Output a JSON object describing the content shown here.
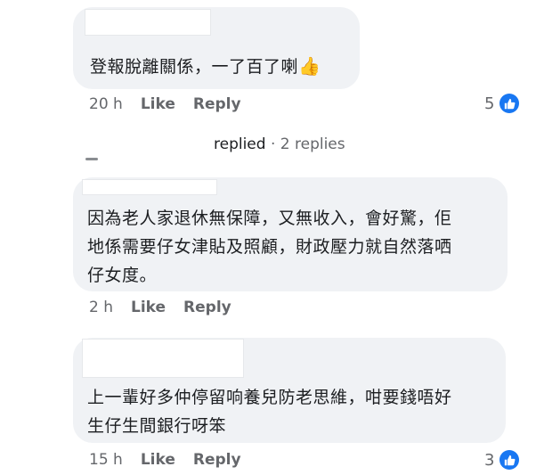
{
  "comments": [
    {
      "text": "登報脫離關係，一了百了喇",
      "emoji": "👍",
      "time": "20 h",
      "like_label": "Like",
      "reply_label": "Reply",
      "reaction_count": "5"
    },
    {
      "text": "因為老人家退休無保障，又無收入，會好驚，佢\n地係需要仔女津貼及照顧，財政壓力就自然落哂\n仔女度。",
      "time": "2 h",
      "like_label": "Like",
      "reply_label": "Reply"
    },
    {
      "text": "上一輩好多仲停留响養兒防老思維，咁要錢唔好\n生仔生間銀行呀笨",
      "time": "15 h",
      "like_label": "Like",
      "reply_label": "Reply",
      "reaction_count": "3"
    }
  ],
  "replies_link": {
    "verb": "replied",
    "count": "· 2 replies"
  },
  "colors": {
    "bubble": "#f0f2f5",
    "meta": "#65676b",
    "like_badge": "#1877f2"
  }
}
